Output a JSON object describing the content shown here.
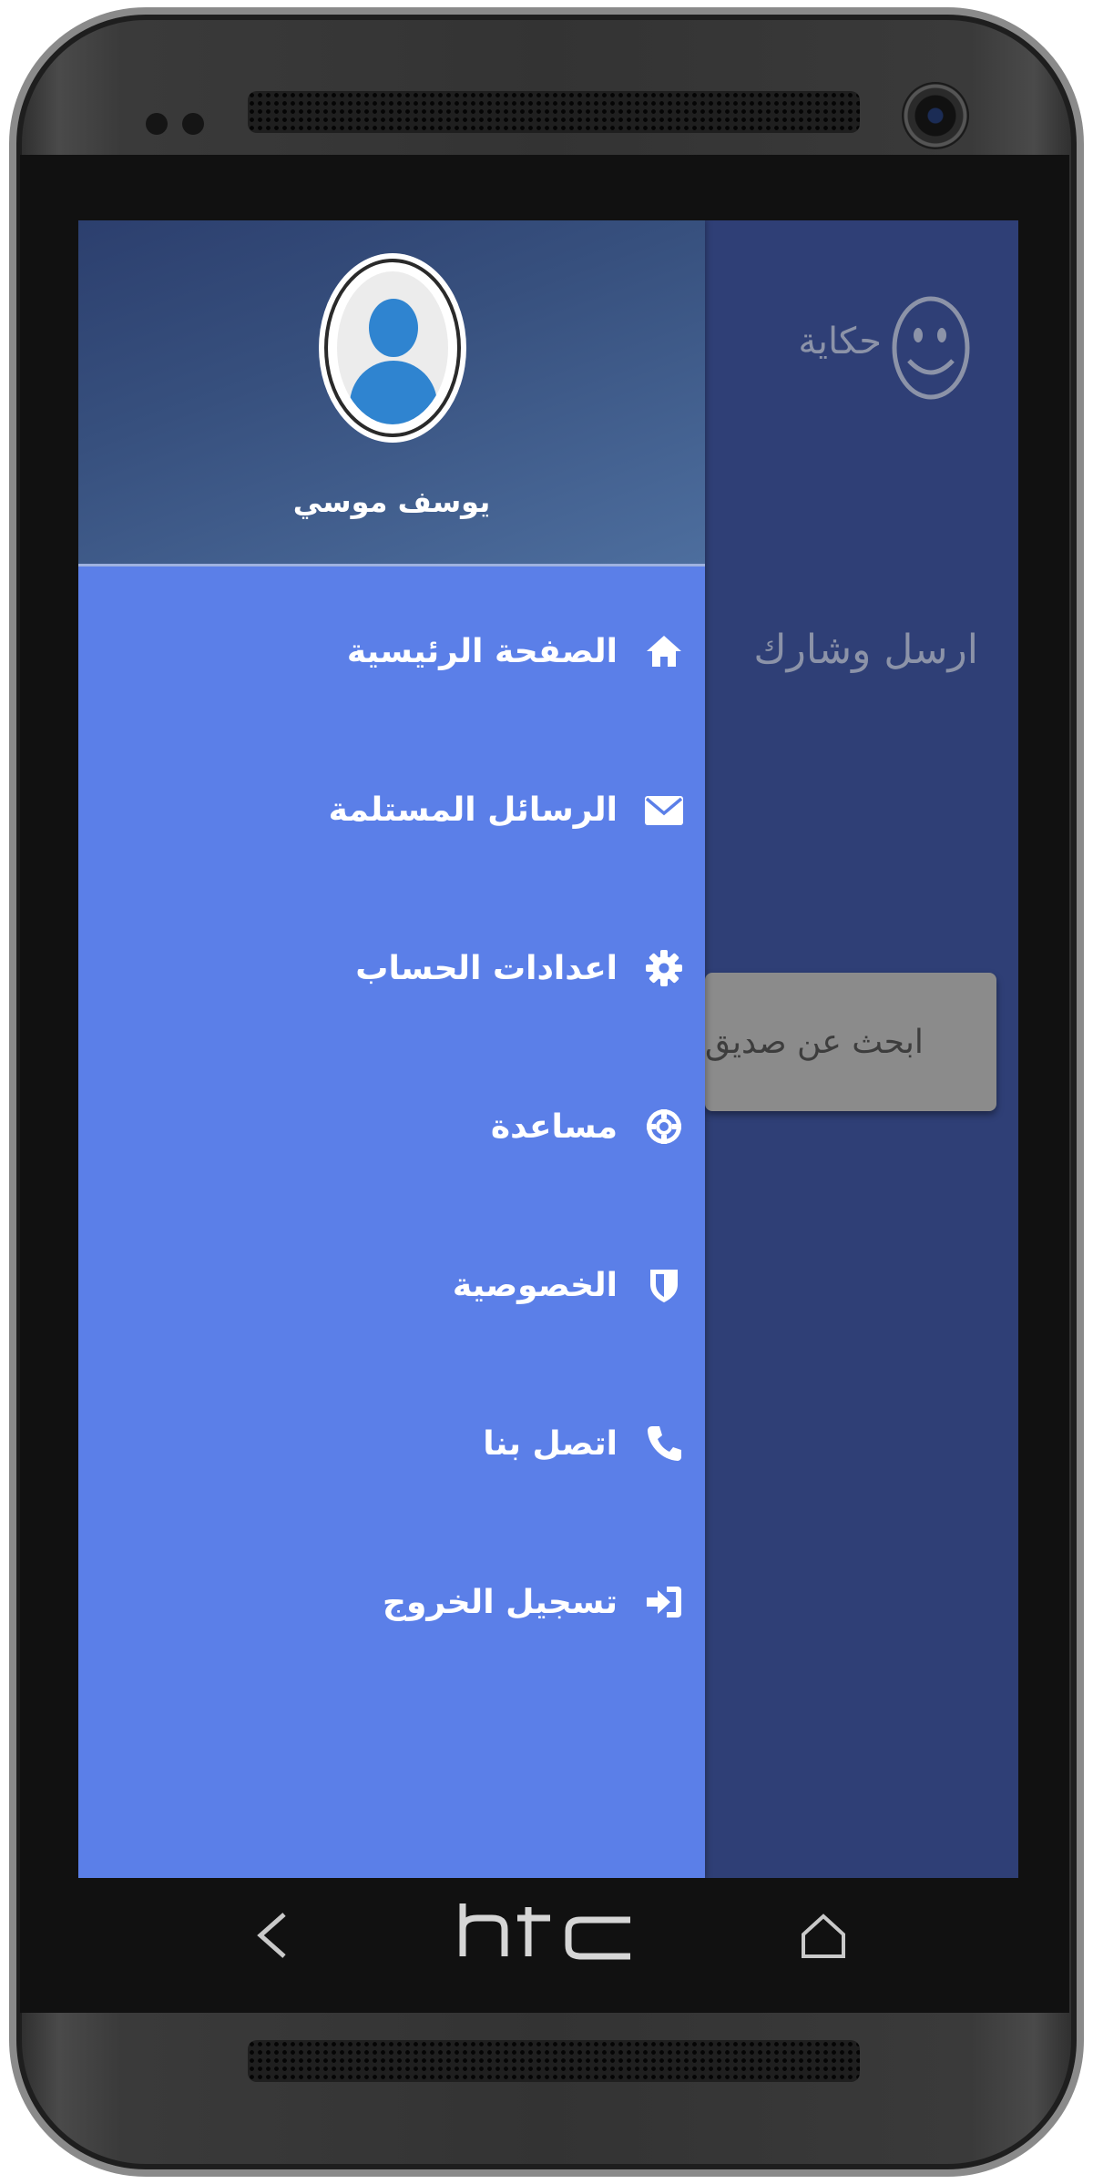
{
  "device": {
    "brand": "htc"
  },
  "app": {
    "name": "حكاية",
    "hero_text": "ارسل وشارك",
    "search_button": "ابحث عن صديق"
  },
  "drawer": {
    "user_name": "يوسف موسي",
    "items": [
      {
        "label": "الصفحة الرئيسية",
        "icon": "home-icon"
      },
      {
        "label": "الرسائل المستلمة",
        "icon": "envelope-icon"
      },
      {
        "label": "اعدادات الحساب",
        "icon": "gear-icon"
      },
      {
        "label": "مساعدة",
        "icon": "lifebuoy-icon"
      },
      {
        "label": "الخصوصية",
        "icon": "shield-icon"
      },
      {
        "label": "اتصل بنا",
        "icon": "phone-icon"
      },
      {
        "label": "تسجيل الخروج",
        "icon": "sign-in-icon"
      }
    ]
  },
  "colors": {
    "drawer_bg": "#5b7fe8",
    "app_bg": "#2f3f76",
    "header_gradient_start": "#2c3f6e",
    "search_button_bg": "#8b8b8b"
  }
}
